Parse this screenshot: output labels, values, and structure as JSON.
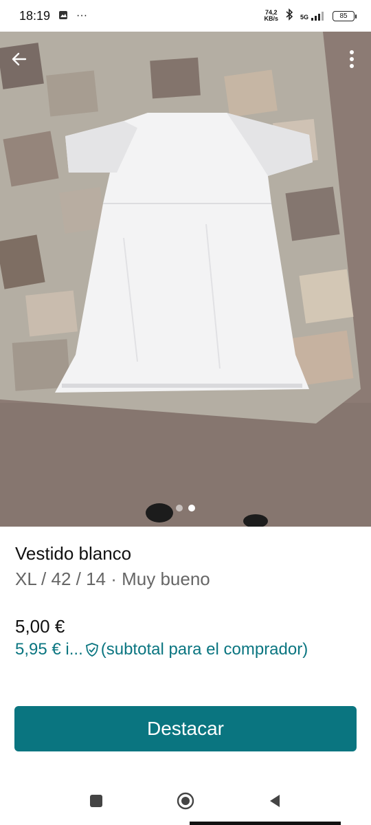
{
  "status_bar": {
    "time": "18:19",
    "ellipsis": "···",
    "net_speed_value": "74,2",
    "net_speed_unit": "KB/s",
    "network": "5G",
    "battery": "85"
  },
  "gallery": {
    "page_count": 2,
    "active_index": 1,
    "icons": {
      "back": "back-arrow-icon",
      "more": "more-vertical-icon"
    }
  },
  "item": {
    "title": "Vestido blanco",
    "details": "XL / 42 / 14 · Muy bueno",
    "price": "5,00 €",
    "buyer_price": "5,95 € i...",
    "buyer_note": "(subtotal para el comprador)"
  },
  "cta": {
    "label": "Destacar"
  },
  "colors": {
    "accent": "#0a7580"
  }
}
